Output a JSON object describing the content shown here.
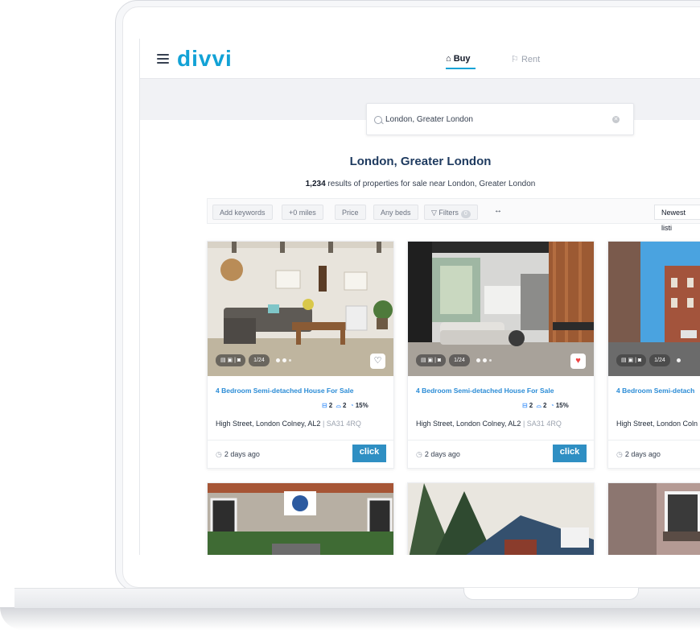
{
  "app": {
    "logo": "divvi"
  },
  "nav": {
    "buy_icon": "⌂",
    "buy_label": "Buy",
    "rent_icon": "⚐",
    "rent_label": "Rent"
  },
  "search": {
    "value": "London, Greater London"
  },
  "page": {
    "title": "London, Greater London",
    "results_count": "1,234",
    "results_text": " results of properties for sale near London, Greater London"
  },
  "filters": {
    "keywords": "Add keywords",
    "miles": "+0 miles",
    "price": "Price",
    "beds": "Any beds",
    "filters_label": "Filters",
    "filters_count": "0",
    "toggle": "↔",
    "sort": "Newest listi"
  },
  "listings": [
    {
      "photo_count": "1/24",
      "title": "4 Bedroom Semi-detached House For Sale",
      "beds": "2",
      "baths": "2",
      "yield": "15%",
      "address": "High Street, London Colney, AL2",
      "postcode": "SA31 4RQ",
      "listed": "2 days ago",
      "agent": "click",
      "favorite": false
    },
    {
      "photo_count": "1/24",
      "title": "4 Bedroom Semi-detached House For Sale",
      "beds": "2",
      "baths": "2",
      "yield": "15%",
      "address": "High Street, London Colney, AL2",
      "postcode": "SA31 4RQ",
      "listed": "2 days ago",
      "agent": "click",
      "favorite": true
    },
    {
      "photo_count": "1/24",
      "title": "4 Bedroom Semi-detach",
      "address": "High Street, London Coln",
      "listed": "2 days ago"
    }
  ],
  "icons": {
    "menu": "menu-icon",
    "search": "search-icon",
    "clear": "clear-icon",
    "heart": "heart-icon",
    "clock": "clock-icon"
  },
  "colors": {
    "brand": "#12a2d6",
    "link": "#2b8cd6",
    "heading": "#1e3a5f",
    "favorite": "#ef4444",
    "agent": "#2f8fc3"
  }
}
